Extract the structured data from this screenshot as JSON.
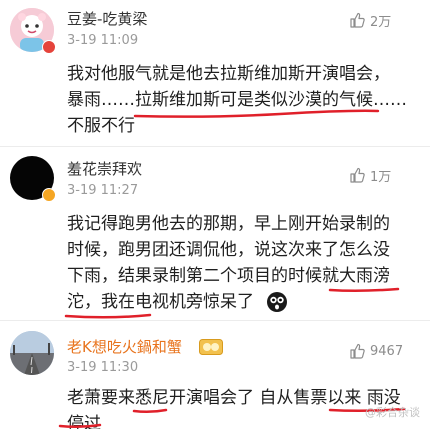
{
  "comments": [
    {
      "username": "豆姜-吃黄梁",
      "timestamp": "3-19 11:09",
      "likes": "2万",
      "lines": [
        "我对他服气就是他去拉斯维加斯开演唱会，",
        "暴雨……拉斯维加斯可是类似沙漠的气候……",
        "不服不行"
      ]
    },
    {
      "username": "羞花崇拜欢",
      "timestamp": "3-19 11:27",
      "likes": "1万",
      "lines": [
        "我记得跑男他去的那期，早上刚开始录制的",
        "时候，跑男团还调侃他，说这次来了怎么没",
        "下雨，结果录制第二个项目的时候就大雨滂",
        "沱，我在电视机旁惊呆了"
      ]
    },
    {
      "username": "老K想吃火鍋和蟹",
      "timestamp": "3-19 11:30",
      "likes": "9467",
      "lines": [
        "老萧要来悉尼开演唱会了 自从售票以来 雨没",
        "停过"
      ]
    }
  ],
  "watermark": "@彩合杂谈",
  "colors": {
    "username_orange": "#e8741e",
    "username_dark": "#333333",
    "annotation_red": "#e0202a",
    "verified_badge": "#f5a623",
    "verified_badge_red": "#e5433b"
  }
}
